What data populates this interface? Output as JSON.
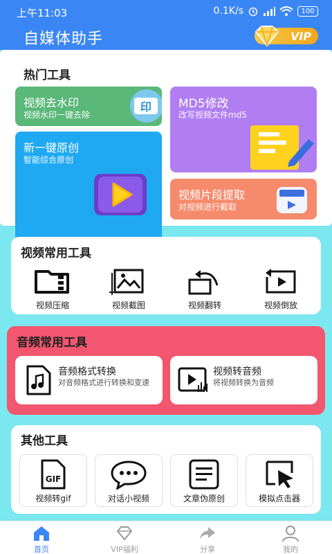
{
  "status_bar": {
    "time": "上午11:03",
    "network_speed": "0.1K/s",
    "battery": "100"
  },
  "header": {
    "title": "自媒体助手",
    "vip_label": "VIP"
  },
  "hot_tools": {
    "title": "热门工具",
    "items": [
      {
        "title": "视频去水印",
        "subtitle": "视频水印一键去除",
        "icon_text": "印"
      },
      {
        "title": "新一键原创",
        "subtitle": "智能综合原创"
      },
      {
        "title": "MD5修改",
        "subtitle": "改写视频文件md5"
      },
      {
        "title": "视频片段提取",
        "subtitle": "对视频进行截取"
      }
    ]
  },
  "video_tools": {
    "title": "视频常用工具",
    "items": [
      {
        "label": "视频压缩",
        "icon": "compress-icon"
      },
      {
        "label": "视频截图",
        "icon": "image-crop-icon"
      },
      {
        "label": "视频翻转",
        "icon": "rotate-icon"
      },
      {
        "label": "视频倒放",
        "icon": "reverse-play-icon"
      }
    ]
  },
  "audio_tools": {
    "title": "音频常用工具",
    "items": [
      {
        "title": "音频格式转换",
        "subtitle": "对音频格式进行转换和变速",
        "icon": "music-file-icon"
      },
      {
        "title": "视频转音频",
        "subtitle": "将视频转换为音频",
        "icon": "video-to-audio-icon"
      }
    ]
  },
  "other_tools": {
    "title": "其他工具",
    "items": [
      {
        "label": "视频转gif",
        "icon": "gif-file-icon",
        "icon_text": "GIF"
      },
      {
        "label": "对话小视频",
        "icon": "chat-bubble-icon"
      },
      {
        "label": "文章伪原创",
        "icon": "document-icon"
      },
      {
        "label": "模拟点击器",
        "icon": "cursor-click-icon"
      }
    ]
  },
  "bottom_nav": {
    "items": [
      {
        "label": "首页",
        "active": true
      },
      {
        "label": "VIP福利",
        "active": false
      },
      {
        "label": "分享",
        "active": false
      },
      {
        "label": "我的",
        "active": false
      }
    ]
  },
  "colors": {
    "header": "#3b86f5",
    "page_bg": "#7be7ee",
    "tile_green": "#5ab879",
    "tile_blue": "#1fa9f2",
    "tile_purple": "#b17ef2",
    "tile_orange": "#f58b6c",
    "audio_bg": "#f2576f",
    "nav_active": "#3b86f5"
  }
}
